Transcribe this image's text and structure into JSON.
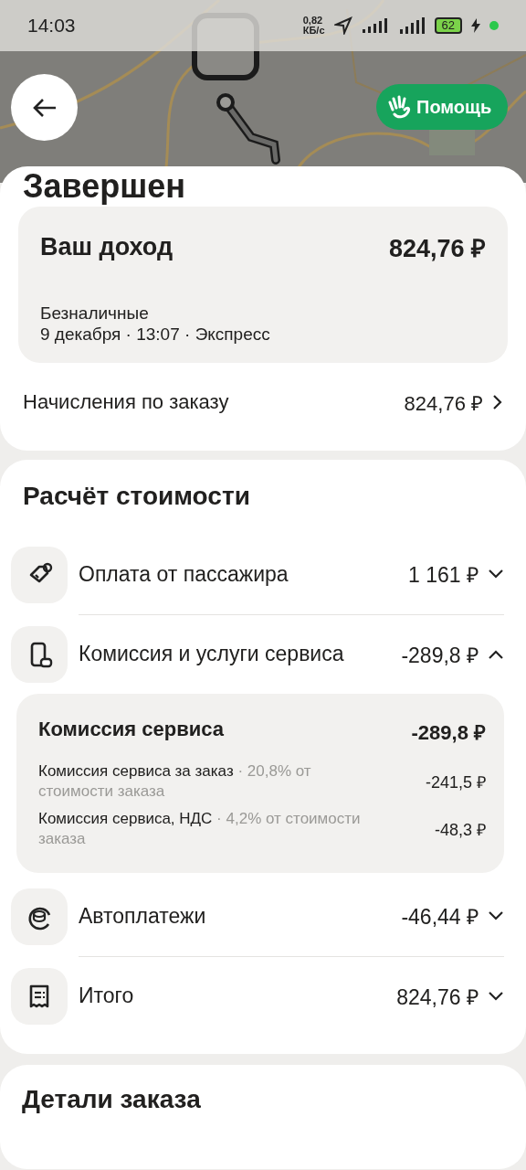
{
  "status_bar": {
    "time": "14:03",
    "speed_value": "0,82",
    "speed_unit": "КБ/с",
    "battery": "62"
  },
  "help_button": {
    "label": "Помощь"
  },
  "order_status": "Завершен",
  "income": {
    "title": "Ваш доход",
    "amount": "824,76 ₽",
    "payment": "Безналичные",
    "meta": "9 декабря · 13:07 · Экспресс"
  },
  "accruals": {
    "label": "Начисления по заказу",
    "amount": "824,76 ₽"
  },
  "cost": {
    "title": "Расчёт стоимости",
    "rows": [
      {
        "kind": "tag",
        "label": "Оплата от пассажира",
        "amount": "1 161 ₽",
        "expanded": false
      },
      {
        "kind": "phone-coin",
        "label": "Комиссия и услуги сервиса",
        "amount": "-289,8 ₽",
        "expanded": true,
        "details": {
          "title": "Комиссия сервиса",
          "amount": "-289,8 ₽",
          "items": [
            {
              "label": "Комиссия сервиса за заказ",
              "note": "· 20,8% от стоимости заказа",
              "amount": "-241,5 ₽"
            },
            {
              "label": "Комиссия сервиса, НДС",
              "note": "· 4,2% от стоимости заказа",
              "amount": "-48,3 ₽"
            }
          ]
        }
      },
      {
        "kind": "coin-cycle",
        "label": "Автоплатежи",
        "amount": "-46,44 ₽",
        "expanded": false
      },
      {
        "kind": "receipt",
        "label": "Итого",
        "amount": "824,76 ₽",
        "expanded": false
      }
    ]
  },
  "order_details": {
    "title": "Детали заказа"
  }
}
